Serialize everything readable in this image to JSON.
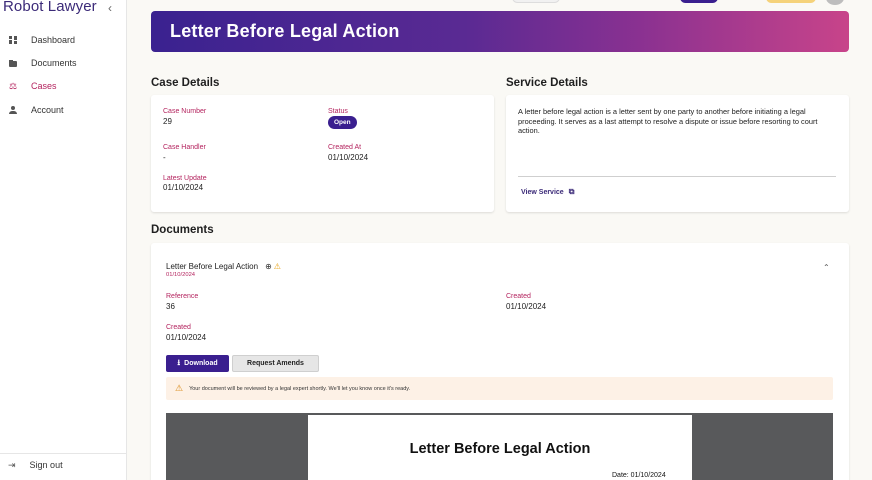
{
  "app": {
    "brand": "Robot Lawyer",
    "collapse_glyph": "‹"
  },
  "sidebar": {
    "items": [
      {
        "label": "Dashboard",
        "icon": "dashboard-icon",
        "active": false
      },
      {
        "label": "Documents",
        "icon": "folder-icon",
        "active": false
      },
      {
        "label": "Cases",
        "icon": "gavel-icon",
        "active": true
      },
      {
        "label": "Account",
        "icon": "user-icon",
        "active": false
      }
    ],
    "signout": {
      "label": "Sign out",
      "icon": "sign-out-icon"
    }
  },
  "banner": {
    "title": "Letter Before Legal Action"
  },
  "case_details": {
    "title": "Case Details",
    "case_number_label": "Case Number",
    "case_number": "29",
    "status_label": "Status",
    "status": "Open",
    "case_handler_label": "Case Handler",
    "case_handler": "-",
    "created_at_label": "Created At",
    "created_at": "01/10/2024",
    "latest_update_label": "Latest Update",
    "latest_update": "01/10/2024"
  },
  "service_details": {
    "title": "Service Details",
    "description": "A letter before legal action is a letter sent by one party to another before initiating a legal proceeding. It serves as a last attempt to resolve a dispute or issue before resorting to court action.",
    "link_label": "View Service"
  },
  "documents": {
    "title": "Documents",
    "item": {
      "name": "Letter Before Legal Action",
      "date": "01/10/2024",
      "reference_label": "Reference",
      "reference": "36",
      "created_label": "Created",
      "created": "01/10/2024",
      "created2_label": "Created",
      "created2": "01/10/2024",
      "download_label": "Download",
      "amend_label": "Request Amends",
      "alert_text": "Your document will be reviewed by a legal expert shortly. We'll let you know once it's ready.",
      "preview_title": "Letter Before Legal Action",
      "preview_date": "Date: 01/10/2024"
    }
  },
  "colors": {
    "accent": "#3a1f8f",
    "label_pink": "#b4235e",
    "banner_start": "#3a2290",
    "banner_end": "#c8448a"
  }
}
